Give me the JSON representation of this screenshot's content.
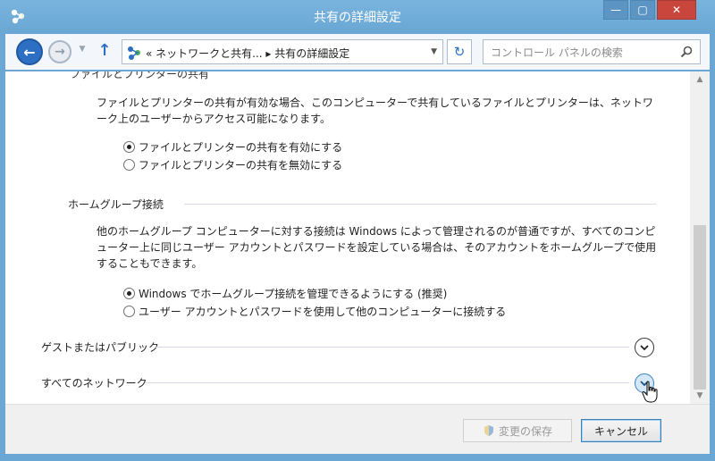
{
  "window": {
    "title": "共有の詳細設定",
    "controls": {
      "minimize": "—",
      "maximize": "▢",
      "close": "✕"
    }
  },
  "navbar": {
    "back_glyph": "←",
    "forward_glyph": "→",
    "up_glyph": "↑",
    "address": "« ネットワークと共有... ▸ 共有の詳細設定",
    "refresh_glyph": "↻",
    "search_placeholder": "コントロール パネルの検索"
  },
  "content": {
    "section_top_title": "ファイルとプリンターの共有",
    "file_sharing_description": "ファイルとプリンターの共有が有効な場合、このコンピューターで共有しているファイルとプリンターは、ネットワーク上のユーザーからアクセス可能になります。",
    "file_sharing_options": [
      {
        "label": "ファイルとプリンターの共有を有効にする",
        "checked": true
      },
      {
        "label": "ファイルとプリンターの共有を無効にする",
        "checked": false
      }
    ],
    "homegroup_title": "ホームグループ接続",
    "homegroup_description": "他のホームグループ コンピューターに対する接続は Windows によって管理されるのが普通ですが、すべてのコンピューター上に同じユーザー アカウントとパスワードを設定している場合は、そのアカウントをホームグループで使用することもできます。",
    "homegroup_options": [
      {
        "label": "Windows でホームグループ接続を管理できるようにする (推奨)",
        "checked": true
      },
      {
        "label": "ユーザー アカウントとパスワードを使用して他のコンピューターに接続する",
        "checked": false
      }
    ],
    "profiles": [
      {
        "label": "ゲストまたはパブリック"
      },
      {
        "label": "すべてのネットワーク"
      }
    ]
  },
  "footer": {
    "save_label": "変更の保存",
    "cancel_label": "キャンセル"
  },
  "colors": {
    "title_bar": "#6aa7d4",
    "close_button": "#c9463d",
    "accent": "#2d6fc2"
  }
}
